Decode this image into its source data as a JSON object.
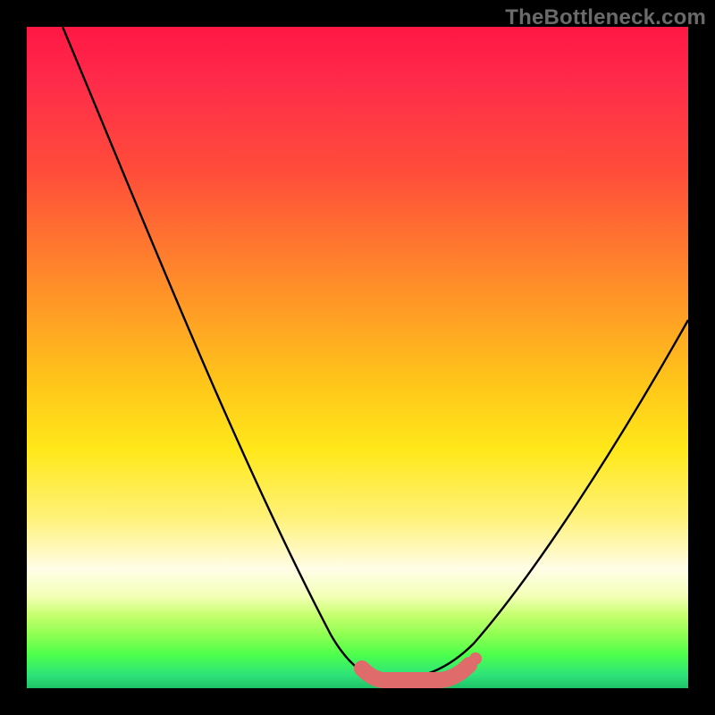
{
  "watermark": "TheBottleneck.com",
  "colors": {
    "background": "#000000",
    "gradient_top": "#ff1744",
    "gradient_bottom": "#1fc167",
    "curve": "#000000",
    "valley_accent": "#e06b6b"
  },
  "chart_data": {
    "type": "line",
    "title": "",
    "xlabel": "",
    "ylabel": "",
    "xlim": [
      0,
      100
    ],
    "ylim": [
      0,
      100
    ],
    "series": [
      {
        "name": "bottleneck-curve",
        "x": [
          0,
          10,
          20,
          30,
          40,
          48,
          52,
          55,
          58,
          62,
          65,
          70,
          80,
          90,
          100
        ],
        "y": [
          100,
          82,
          64,
          46,
          28,
          10,
          3,
          1,
          1,
          3,
          8,
          18,
          34,
          48,
          60
        ]
      }
    ],
    "annotations": [
      {
        "text": "valley-marker",
        "x_start": 52,
        "x_end": 62,
        "y": 1
      }
    ]
  }
}
